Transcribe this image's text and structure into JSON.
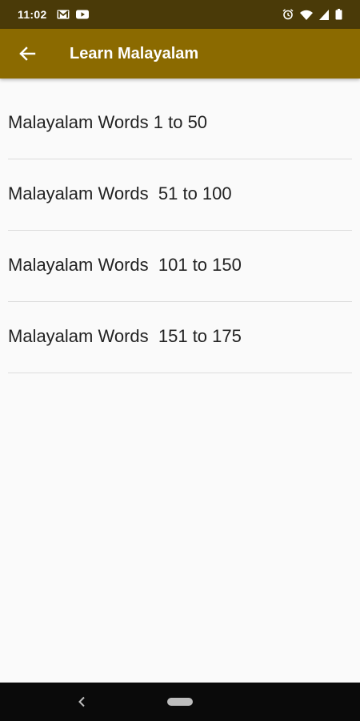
{
  "status_bar": {
    "time": "11:02",
    "left_icons": [
      "gmail-icon",
      "youtube-icon"
    ],
    "right_icons": [
      "alarm-icon",
      "wifi-icon",
      "signal-icon",
      "battery-icon"
    ]
  },
  "app_bar": {
    "title": "Learn Malayalam",
    "back_icon": "arrow-left-icon"
  },
  "list": {
    "items": [
      {
        "label": "Malayalam Words 1 to 50"
      },
      {
        "label": "Malayalam Words  51 to 100"
      },
      {
        "label": "Malayalam Words  101 to 150"
      },
      {
        "label": "Malayalam Words  151 to 175"
      }
    ]
  },
  "nav_bar": {
    "back_icon": "chevron-left-icon",
    "home_icon": "home-pill-icon"
  },
  "colors": {
    "status_bar": "#4a3a08",
    "app_bar": "#8b6a00",
    "background": "#fafafa",
    "divider": "#dcdcdc",
    "nav_bar": "#0a0a0a"
  }
}
